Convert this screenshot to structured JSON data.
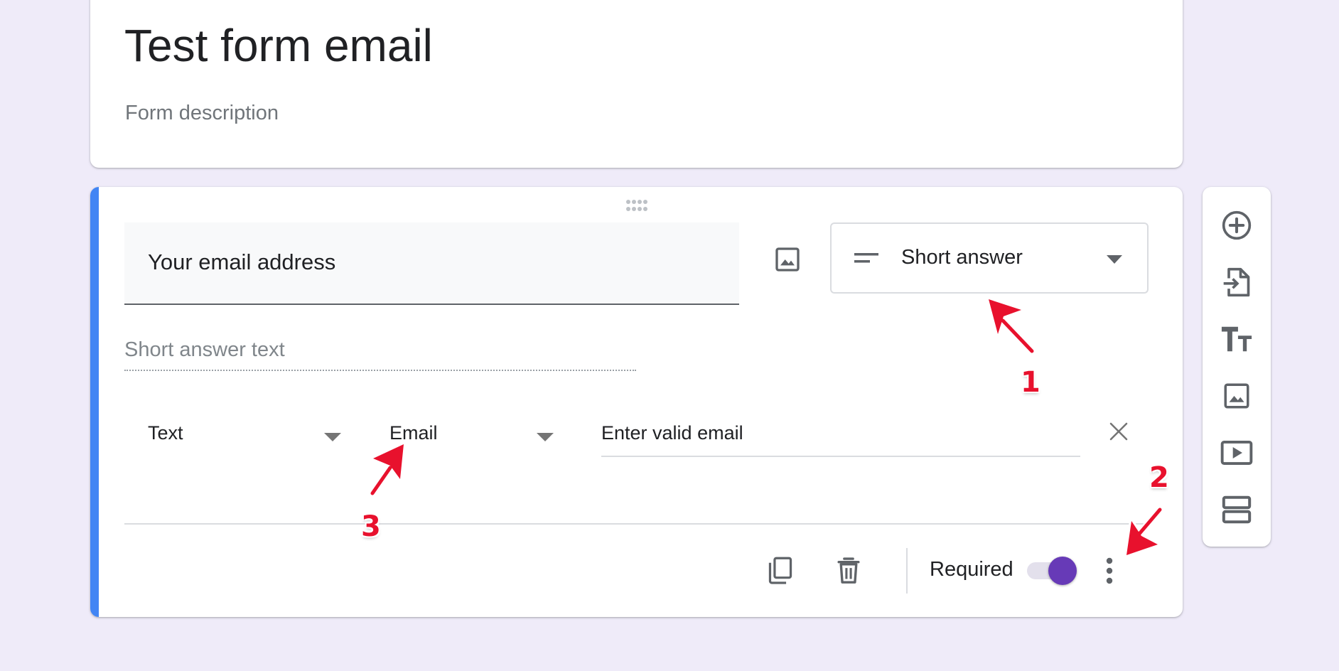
{
  "form": {
    "title": "Test form email",
    "description_placeholder": "Form description"
  },
  "question": {
    "title": "Your email address",
    "type_label": "Short answer",
    "answer_placeholder": "Short answer text",
    "validation": {
      "type": "Text",
      "rule": "Email",
      "error_text": "Enter valid email"
    },
    "required_label": "Required",
    "required_on": true
  },
  "annotations": [
    "1",
    "2",
    "3"
  ],
  "colors": {
    "background": "#efebf9",
    "accent_bar": "#4285f4",
    "toggle": "#673ab7",
    "annotation": "#e8112d"
  },
  "icons": {
    "drag_handle": "drag-dots-icon",
    "add_image": "image-icon",
    "question_type": "short-text-icon",
    "caret": "caret-down-icon",
    "remove": "close-icon",
    "duplicate": "copy-icon",
    "delete": "trash-icon",
    "more": "more-vert-icon",
    "toolbar": [
      "add-circle-icon",
      "import-icon",
      "title-text-icon",
      "image-icon",
      "video-icon",
      "section-icon"
    ]
  }
}
